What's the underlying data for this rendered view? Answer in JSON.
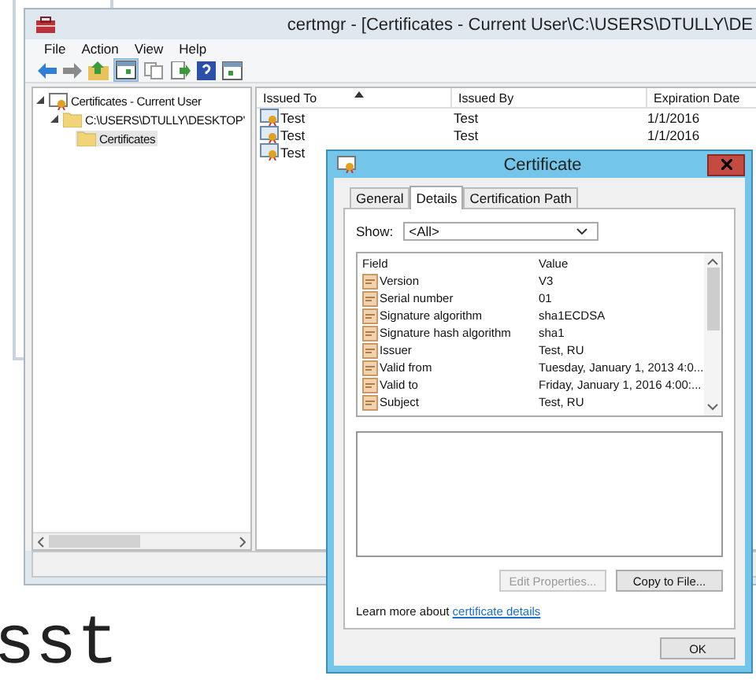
{
  "background_text": "sst",
  "main_window": {
    "title": "certmgr - [Certificates - Current User\\C:\\USERS\\DTULLY\\DE",
    "menu": [
      "File",
      "Action",
      "View",
      "Help"
    ],
    "tree": [
      {
        "label": "Certificates - Current User",
        "kind": "store",
        "expanded": true,
        "selected": false,
        "children": [
          {
            "label": "C:\\USERS\\DTULLY\\DESKTOP'",
            "kind": "folder",
            "expanded": true,
            "selected": false,
            "children": [
              {
                "label": "Certificates",
                "kind": "folder",
                "selected": true
              }
            ]
          }
        ]
      }
    ],
    "table": {
      "columns": [
        "Issued To",
        "Issued By",
        "Expiration Date"
      ],
      "rows": [
        [
          "Test",
          "Test",
          "1/1/2016"
        ],
        [
          "Test",
          "Test",
          "1/1/2016"
        ],
        [
          "Test"
        ]
      ]
    }
  },
  "dialog": {
    "title": "Certificate",
    "tabs": [
      {
        "label": "General",
        "selected": false
      },
      {
        "label": "Details",
        "selected": true
      },
      {
        "label": "Certification Path",
        "selected": false
      }
    ],
    "show_label": "Show:",
    "show_value": "<All>",
    "columns": [
      "Field",
      "Value"
    ],
    "fields": [
      {
        "field": "Version",
        "value": "V3"
      },
      {
        "field": "Serial number",
        "value": "01"
      },
      {
        "field": "Signature algorithm",
        "value": "sha1ECDSA"
      },
      {
        "field": "Signature hash algorithm",
        "value": "sha1"
      },
      {
        "field": "Issuer",
        "value": "Test, RU"
      },
      {
        "field": "Valid from",
        "value": "Tuesday, January 1, 2013 4:0..."
      },
      {
        "field": "Valid to",
        "value": "Friday, January 1, 2016 4:00:..."
      },
      {
        "field": "Subject",
        "value": "Test, RU"
      }
    ],
    "buttons": [
      {
        "label": "Edit Properties...",
        "disabled": true
      },
      {
        "label": "Copy to File...",
        "disabled": false
      }
    ],
    "learn_more": {
      "text": "Learn more about",
      "link": "certificate details"
    },
    "ok": "OK"
  }
}
